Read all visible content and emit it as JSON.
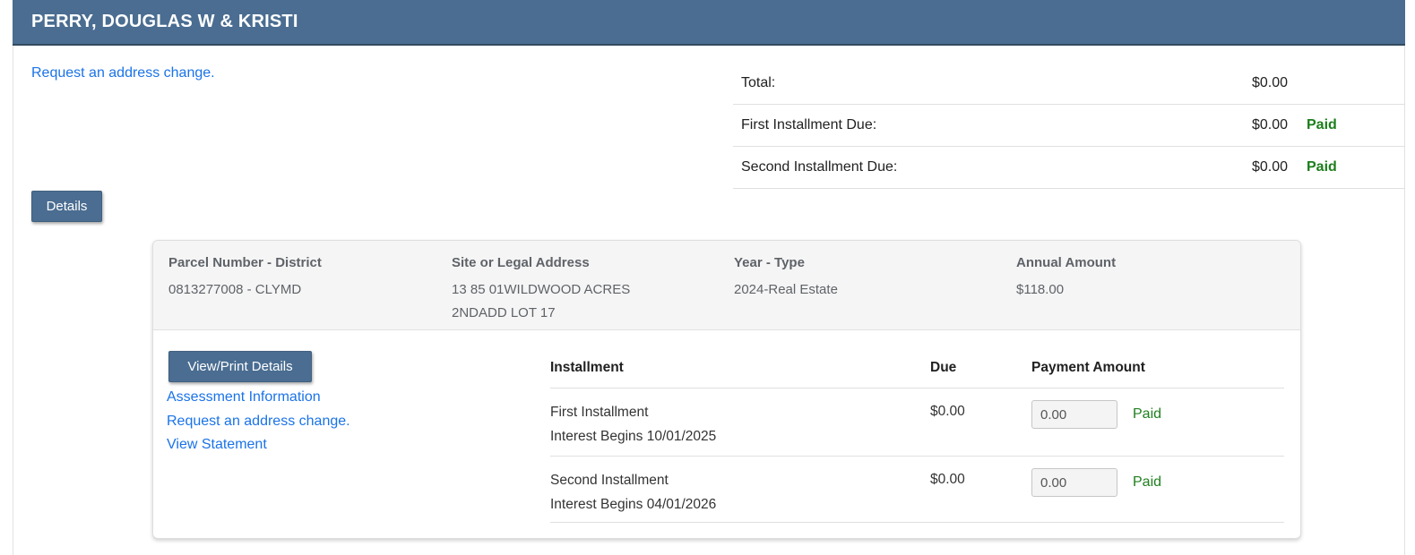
{
  "header": {
    "title": "PERRY, DOUGLAS W & KRISTI"
  },
  "top_link": {
    "label": "Request an address change."
  },
  "summary": {
    "rows": [
      {
        "label": "Total:",
        "value": "$0.00",
        "status": ""
      },
      {
        "label": "First Installment Due:",
        "value": "$0.00",
        "status": "Paid"
      },
      {
        "label": "Second Installment Due:",
        "value": "$0.00",
        "status": "Paid"
      }
    ]
  },
  "details_button": {
    "label": "Details"
  },
  "parcel": {
    "columns": [
      {
        "label": "Parcel Number - District",
        "value": "0813277008 - CLYMD"
      },
      {
        "label": "Site or Legal Address",
        "value": "13 85 01WILDWOOD ACRES 2NDADD LOT 17"
      },
      {
        "label": "Year - Type",
        "value": "2024-Real Estate"
      },
      {
        "label": "Annual Amount",
        "value": "$118.00"
      }
    ],
    "actions": {
      "view_print_button": "View/Print Details",
      "links": [
        {
          "label": "Assessment Information"
        },
        {
          "label": "Request an address change."
        },
        {
          "label": "View Statement"
        }
      ]
    },
    "installments": {
      "headers": {
        "installment": "Installment",
        "due": "Due",
        "payment_amount": "Payment Amount"
      },
      "rows": [
        {
          "name": "First Installment",
          "interest": "Interest Begins 10/01/2025",
          "due": "$0.00",
          "payment_value": "0.00",
          "status": "Paid"
        },
        {
          "name": "Second Installment",
          "interest": "Interest Begins 04/01/2026",
          "due": "$0.00",
          "payment_value": "0.00",
          "status": "Paid"
        }
      ]
    }
  },
  "colors": {
    "header_bar": "#4a6d91",
    "header_bar_border": "#33495e",
    "link_blue": "#1a73e8",
    "paid_green": "#1b7e1b",
    "divider": "#e0e0e0",
    "card_header_bg": "#f5f5f5"
  }
}
